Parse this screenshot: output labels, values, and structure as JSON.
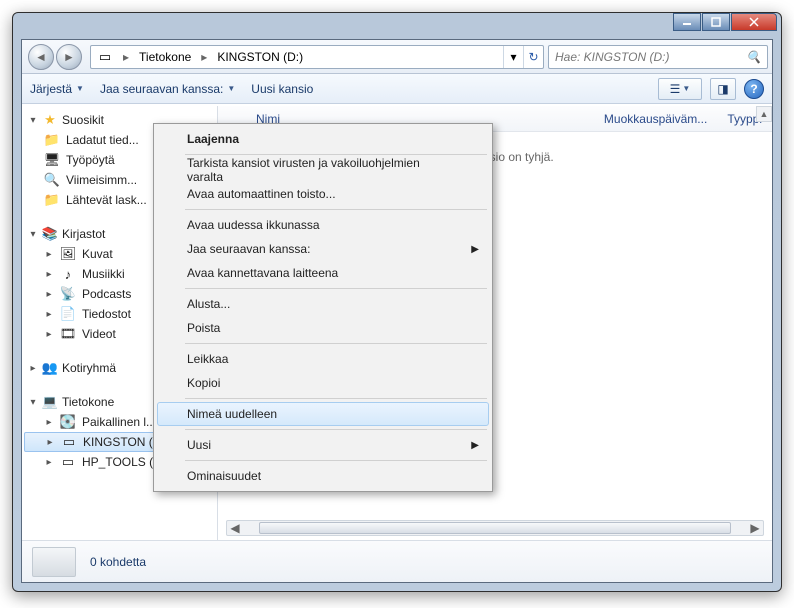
{
  "titlebar": {
    "min": "—",
    "max": "☐",
    "close": "✕"
  },
  "breadcrumb": {
    "root_icon": "drive",
    "items": [
      "Tietokone",
      "KINGSTON (D:)"
    ]
  },
  "search": {
    "placeholder": "Hae: KINGSTON (D:)"
  },
  "toolbar": {
    "organize": "Järjestä",
    "share": "Jaa seuraavan kanssa:",
    "newfolder": "Uusi kansio"
  },
  "columns": {
    "name": "Nimi",
    "modified": "Muokkauspäiväm...",
    "type": "Tyyppi"
  },
  "empty": "Tämä kansio on tyhjä.",
  "nav": {
    "favorites": {
      "label": "Suosikit",
      "items": [
        "Ladatut tied...",
        "Työpöytä",
        "Viimeisimm...",
        "Lähtevät lask..."
      ]
    },
    "libraries": {
      "label": "Kirjastot",
      "items": [
        "Kuvat",
        "Musiikki",
        "Podcasts",
        "Tiedostot",
        "Videot"
      ]
    },
    "homegroup": {
      "label": "Kotiryhmä"
    },
    "computer": {
      "label": "Tietokone",
      "items": [
        "Paikallinen l...",
        "KINGSTON (D:)",
        "HP_TOOLS (F:)"
      ]
    }
  },
  "status": {
    "text": "0 kohdetta"
  },
  "context": {
    "expand": "Laajenna",
    "scan": "Tarkista kansiot virusten ja vakoiluohjelmien varalta",
    "autoplay": "Avaa automaattinen toisto...",
    "newwin": "Avaa uudessa ikkunassa",
    "sharewith": "Jaa seuraavan kanssa:",
    "portable": "Avaa kannettavana laitteena",
    "format": "Alusta...",
    "delete": "Poista",
    "cut": "Leikkaa",
    "copy": "Kopioi",
    "rename": "Nimeä uudelleen",
    "new": "Uusi",
    "properties": "Ominaisuudet"
  }
}
